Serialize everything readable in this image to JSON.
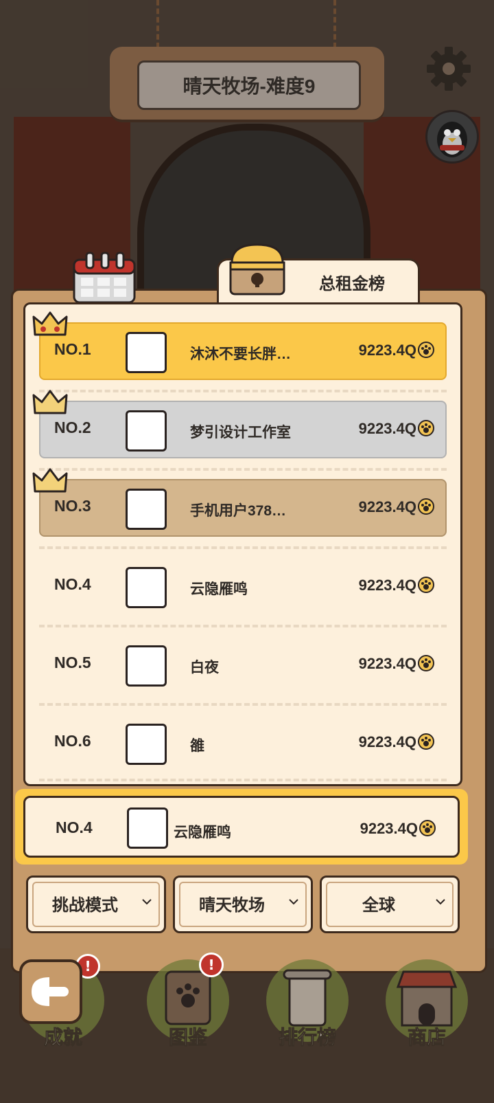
{
  "header": {
    "title": "晴天牧场-难度9"
  },
  "leaderboard": {
    "tab_label": "总租金榜",
    "rows": [
      {
        "rank": "NO.1",
        "name": "沐沐不要长胖…",
        "score": "9223.4Q"
      },
      {
        "rank": "NO.2",
        "name": "梦引设计工作室",
        "score": "9223.4Q"
      },
      {
        "rank": "NO.3",
        "name": "手机用户378…",
        "score": "9223.4Q"
      },
      {
        "rank": "NO.4",
        "name": "云隐雁鸣",
        "score": "9223.4Q"
      },
      {
        "rank": "NO.5",
        "name": "白夜",
        "score": "9223.4Q"
      },
      {
        "rank": "NO.6",
        "name": "雒",
        "score": "9223.4Q"
      }
    ],
    "my_rank": {
      "rank": "NO.4",
      "name": "云隐雁鸣",
      "score": "9223.4Q"
    }
  },
  "filters": {
    "mode": "挑战模式",
    "farm": "晴天牧场",
    "region": "全球"
  },
  "nav": {
    "achievements": "成就",
    "collection": "图鉴",
    "leaderboard": "排行榜",
    "shop": "商店",
    "badge_mark": "!"
  },
  "colors": {
    "gold_row": "#fbc849",
    "silver_row": "#d3d3d3",
    "bronze_row": "#d4b68d",
    "panel": "#c69a6a",
    "paper": "#fdf0dc"
  }
}
